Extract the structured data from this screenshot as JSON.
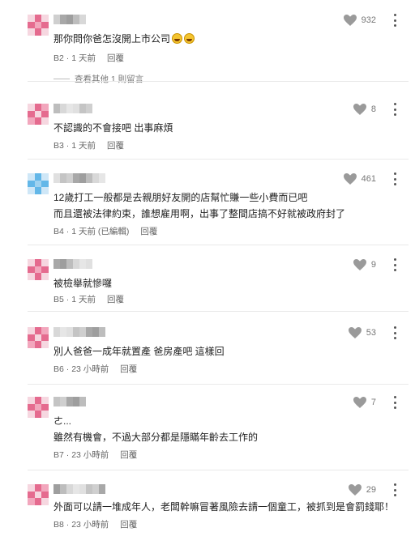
{
  "like_color": "#9a9a9a",
  "comments": [
    {
      "floor": "B2",
      "time": "1 天前",
      "reply": "回覆",
      "likes": "932",
      "lines": [
        "那你問你爸怎沒開上市公司"
      ],
      "emoji": "laughing-emoji",
      "view_more": "查看其他 1 則留言",
      "avatar_colors": [
        "#f6d7e0",
        "#e56b8f",
        "#f6d7e0",
        "#e56b8f",
        "#f2a7bd",
        "#e56b8f",
        "#f6d7e0",
        "#e56b8f",
        "#f6d7e0"
      ]
    },
    {
      "floor": "B3",
      "time": "1 天前",
      "reply": "回覆",
      "likes": "8",
      "lines": [
        "不認識的不會接吧 出事麻煩"
      ],
      "avatar_colors": [
        "#f6d7e0",
        "#e56b8f",
        "#f2a7bd",
        "#e56b8f",
        "#f6d7e0",
        "#e56b8f",
        "#f2a7bd",
        "#e56b8f",
        "#f6d7e0"
      ]
    },
    {
      "floor": "B4",
      "time": "1 天前 (已編輯)",
      "reply": "回覆",
      "likes": "461",
      "lines": [
        "12歲打工一般都是去親朋好友開的店幫忙賺一些小費而已吧",
        "而且還被法律約束，誰想雇用啊，出事了整間店搞不好就被政府封了"
      ],
      "avatar_colors": [
        "#cfe7f7",
        "#63b7e8",
        "#cfe7f7",
        "#63b7e8",
        "#9fd2f0",
        "#63b7e8",
        "#cfe7f7",
        "#63b7e8",
        "#cfe7f7"
      ]
    },
    {
      "floor": "B5",
      "time": "1 天前",
      "reply": "回覆",
      "likes": "9",
      "lines": [
        "被檢舉就慘囉"
      ],
      "avatar_colors": [
        "#f6d7e0",
        "#e56b8f",
        "#f6d7e0",
        "#e56b8f",
        "#f2a7bd",
        "#e56b8f",
        "#f6d7e0",
        "#e56b8f",
        "#f6d7e0"
      ]
    },
    {
      "floor": "B6",
      "time": "23 小時前",
      "reply": "回覆",
      "likes": "53",
      "lines": [
        "別人爸爸一成年就置產 爸房產吧 這樣回"
      ],
      "avatar_colors": [
        "#f6d7e0",
        "#e56b8f",
        "#f2a7bd",
        "#e56b8f",
        "#f6d7e0",
        "#e56b8f",
        "#f2a7bd",
        "#e56b8f",
        "#f6d7e0"
      ]
    },
    {
      "floor": "B7",
      "time": "23 小時前",
      "reply": "回覆",
      "likes": "7",
      "lines": [
        "ㄜ...",
        "雖然有機會，不過大部分都是隱瞞年齡去工作的"
      ],
      "avatar_colors": [
        "#f6d7e0",
        "#e56b8f",
        "#f6d7e0",
        "#e56b8f",
        "#f2a7bd",
        "#e56b8f",
        "#f6d7e0",
        "#e56b8f",
        "#f6d7e0"
      ]
    },
    {
      "floor": "B8",
      "time": "23 小時前",
      "reply": "回覆",
      "likes": "29",
      "lines": [
        "外面可以請一堆成年人，老闆幹嘛冒著風險去請一個童工，被抓到是會罰錢耶！"
      ],
      "avatar_colors": [
        "#f6d7e0",
        "#e56b8f",
        "#f2a7bd",
        "#e56b8f",
        "#f6d7e0",
        "#e56b8f",
        "#f2a7bd",
        "#e56b8f",
        "#f6d7e0"
      ]
    }
  ]
}
